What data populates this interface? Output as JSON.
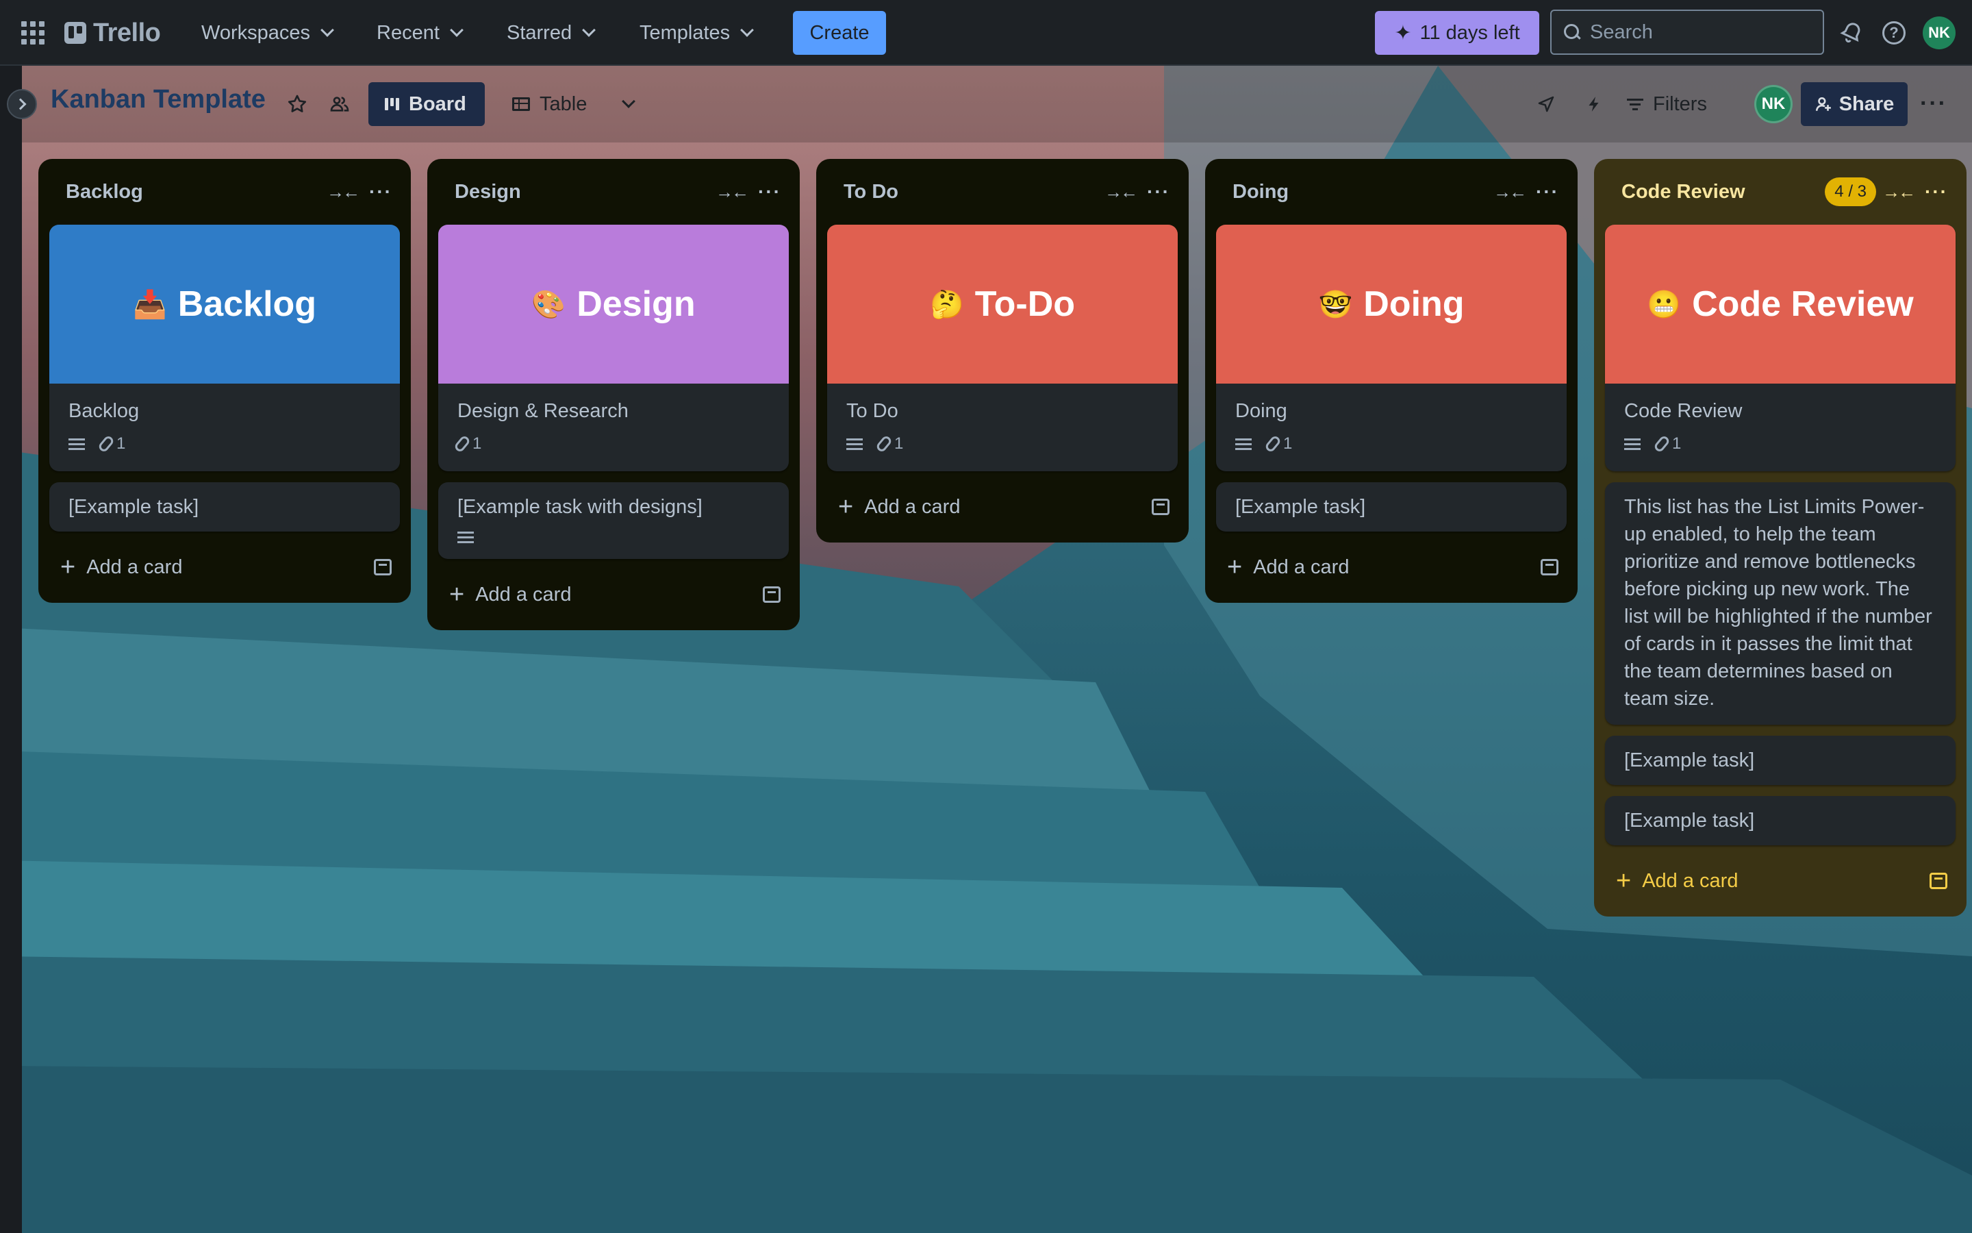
{
  "nav": {
    "logo": "Trello",
    "menus": [
      {
        "label": "Workspaces"
      },
      {
        "label": "Recent"
      },
      {
        "label": "Starred"
      },
      {
        "label": "Templates"
      }
    ],
    "create_label": "Create",
    "trial_label": "11 days left",
    "search_placeholder": "Search",
    "avatar_initials": "NK"
  },
  "board": {
    "title": "Kanban Template",
    "views": {
      "board": "Board",
      "table": "Table"
    },
    "filters_label": "Filters",
    "member_initials": "NK",
    "share_label": "Share"
  },
  "lists": [
    {
      "title": "Backlog",
      "cover": {
        "emoji": "📥",
        "text": "Backlog",
        "color": "#2F7CC7"
      },
      "cover_card_title": "Backlog",
      "attachments": "1",
      "cards": [
        "[Example task]"
      ],
      "add_label": "Add a card"
    },
    {
      "title": "Design",
      "cover": {
        "emoji": "🎨",
        "text": "Design",
        "color": "#B97CDB"
      },
      "cover_card_title": "Design & Research",
      "attachments": "1",
      "cards": [
        "[Example task with designs]"
      ],
      "add_label": "Add a card"
    },
    {
      "title": "To Do",
      "cover": {
        "emoji": "🤔",
        "text": "To-Do",
        "color": "#E06050"
      },
      "cover_card_title": "To Do",
      "attachments": "1",
      "cards": [],
      "add_label": "Add a card"
    },
    {
      "title": "Doing",
      "cover": {
        "emoji": "🤓",
        "text": "Doing",
        "color": "#E06050"
      },
      "cover_card_title": "Doing",
      "attachments": "1",
      "cards": [
        "[Example task]"
      ],
      "add_label": "Add a card"
    },
    {
      "title": "Code Review",
      "limit": "4 / 3",
      "cover": {
        "emoji": "😬",
        "text": "Code Review",
        "color": "#E06050"
      },
      "cover_card_title": "Code Review",
      "attachments": "1",
      "note": "This list has the List Limits Power-up enabled, to help the team prioritize and remove bottlenecks before picking up new work. The list will be highlighted if the number of cards in it passes the limit that the team determines based on team size.",
      "cards": [
        "[Example task]",
        "[Example task]"
      ],
      "add_label": "Add a card"
    }
  ]
}
